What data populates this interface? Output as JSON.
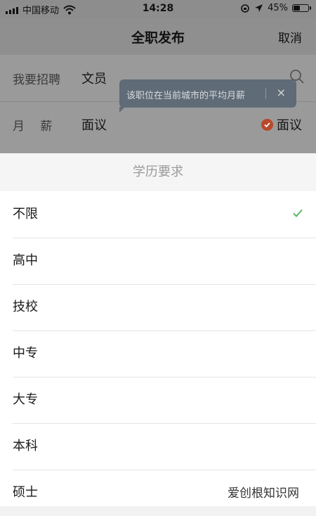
{
  "status_bar": {
    "carrier": "中国移动",
    "time": "14:28",
    "battery_percent": "45%",
    "battery_level": 0.45
  },
  "nav": {
    "title": "全职发布",
    "cancel": "取消"
  },
  "form": {
    "recruit_label": "我要招聘",
    "recruit_value": "文员",
    "salary_label": "月　 薪",
    "salary_value": "面议",
    "negotiable_label": "面议"
  },
  "tooltip": {
    "text": "该职位在当前城市的平均月薪",
    "close": "×"
  },
  "sheet": {
    "title": "学历要求",
    "options": [
      "不限",
      "高中",
      "技校",
      "中专",
      "大专",
      "本科",
      "硕士"
    ],
    "selected_index": 0
  },
  "watermark": "爱创根知识网",
  "colors": {
    "accent_check": "#5cb85c",
    "negotiable_badge": "#b9482b"
  }
}
